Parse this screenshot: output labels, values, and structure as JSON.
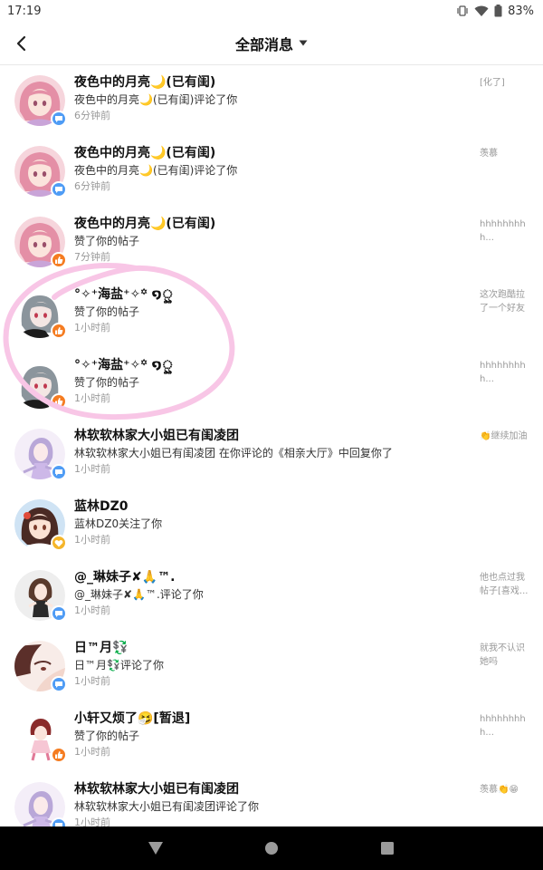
{
  "status": {
    "time": "17:19",
    "battery": "83%"
  },
  "header": {
    "title": "全部消息"
  },
  "colors": {
    "badge_reply": "#4f9cf5",
    "badge_like": "#f57c21",
    "badge_follow": "#f5b52a",
    "annotation": "#f8c6e6"
  },
  "messages": [
    {
      "name": "夜色中的月亮🌙(已有闺)",
      "action": "夜色中的月亮🌙(已有闺)评论了你",
      "time": "6分钟前",
      "snippet": "[化了]",
      "badge": "comment-icon"
    },
    {
      "name": "夜色中的月亮🌙(已有闺)",
      "action": "夜色中的月亮🌙(已有闺)评论了你",
      "time": "6分钟前",
      "snippet": "羡慕",
      "badge": "comment-icon"
    },
    {
      "name": "夜色中的月亮🌙(已有闺)",
      "action": "赞了你的帖子",
      "time": "7分钟前",
      "snippet": "hhhhhhhhh...",
      "badge": "thumbs-up-icon"
    },
    {
      "name": "°✧⁺海盐⁺✧꙳ ໑ৣ",
      "action": "赞了你的帖子",
      "time": "1小时前",
      "snippet": "这次跑酷拉了一个好友",
      "badge": "thumbs-up-icon"
    },
    {
      "name": "°✧⁺海盐⁺✧꙳ ໑ৣ",
      "action": "赞了你的帖子",
      "time": "1小时前",
      "snippet": "hhhhhhhhh...",
      "badge": "thumbs-up-icon"
    },
    {
      "name": "林软软林家大小姐已有闺凌团",
      "action": "林软软林家大小姐已有闺凌团 在你评论的《相亲大厅》中回复你了",
      "time": "1小时前",
      "snippet": "👏继续加油",
      "badge": "comment-icon"
    },
    {
      "name": "蓝林DZ0",
      "action": "蓝林DZ0关注了你",
      "time": "1小时前",
      "snippet": "",
      "badge": "heart-icon"
    },
    {
      "name": "@_琳妹子✘🙏™.",
      "action": "@_琳妹子✘🙏™.评论了你",
      "time": "1小时前",
      "snippet": "他也点过我帖子[喜戏...",
      "badge": "comment-icon"
    },
    {
      "name": "日™月💱",
      "action": "日™月💱评论了你",
      "time": "1小时前",
      "snippet": "就我不认识她吗",
      "badge": "comment-icon"
    },
    {
      "name": "小轩又烦了🤧[暂退]",
      "action": "赞了你的帖子",
      "time": "1小时前",
      "snippet": "hhhhhhhhh...",
      "badge": "thumbs-up-icon"
    },
    {
      "name": "林软软林家大小姐已有闺凌团",
      "action": "林软软林家大小姐已有闺凌团评论了你",
      "time": "1小时前",
      "snippet": "羡慕👏😁",
      "badge": "comment-icon"
    }
  ]
}
